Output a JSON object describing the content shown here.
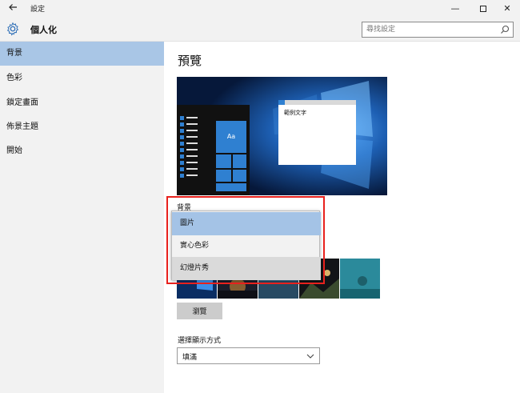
{
  "window": {
    "title": "設定"
  },
  "header": {
    "page_name": "個人化",
    "search_placeholder": "尋找設定"
  },
  "sidebar": {
    "items": [
      {
        "label": "背景",
        "active": true
      },
      {
        "label": "色彩",
        "active": false
      },
      {
        "label": "鎖定畫面",
        "active": false
      },
      {
        "label": "佈景主題",
        "active": false
      },
      {
        "label": "開始",
        "active": false
      }
    ]
  },
  "main": {
    "title": "預覽",
    "preview": {
      "sample_text": "範例文字",
      "tile_text": "Aa"
    },
    "background_label": "背景",
    "background_options": [
      {
        "label": "圖片",
        "state": "selected"
      },
      {
        "label": "實心色彩",
        "state": "normal"
      },
      {
        "label": "幻燈片秀",
        "state": "hover"
      }
    ],
    "browse_button": "瀏覽",
    "fit_label": "選擇顯示方式",
    "fit_value": "填滿"
  },
  "colors": {
    "accent": "#2f80d1",
    "selected": "#a9c6e6",
    "highlight_border": "#e8211d"
  }
}
